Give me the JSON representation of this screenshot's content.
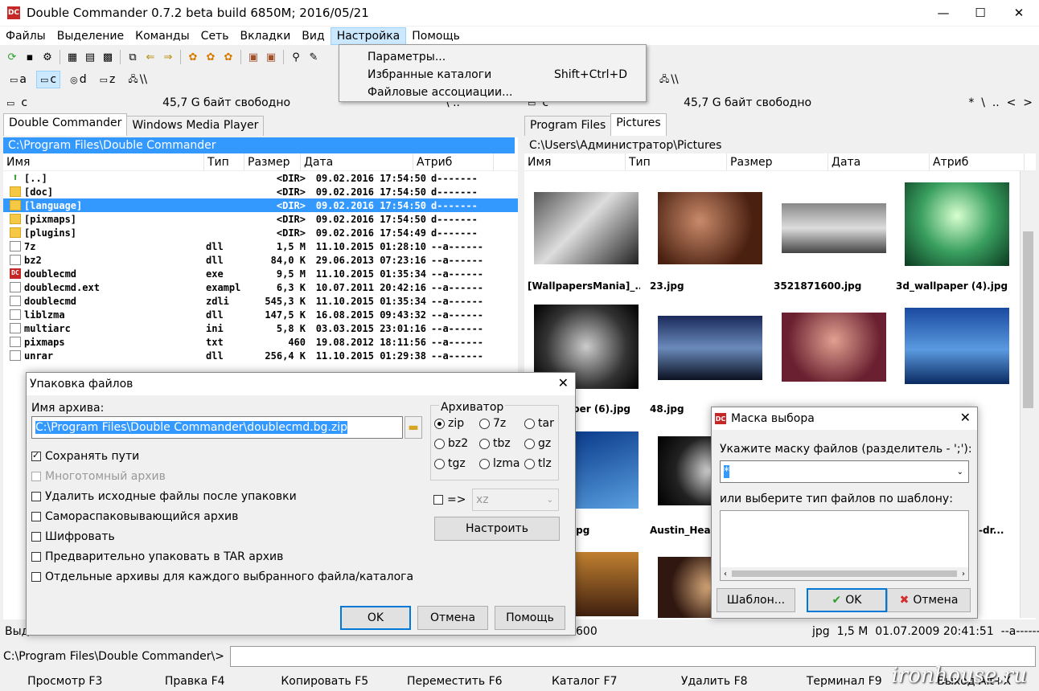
{
  "window": {
    "title": "Double Commander 0.7.2 beta build 6850M; 2016/05/21",
    "app_icon": "DC"
  },
  "menu": [
    "Файлы",
    "Выделение",
    "Команды",
    "Сеть",
    "Вкладки",
    "Вид",
    "Настройка",
    "Помощь"
  ],
  "settings_menu": {
    "items": [
      {
        "label": "Параметры...",
        "shortcut": ""
      },
      {
        "label": "Избранные каталоги",
        "shortcut": "Shift+Ctrl+D"
      },
      {
        "label": "Файловые ассоциации...",
        "shortcut": ""
      }
    ]
  },
  "left_drives": [
    "a",
    "c",
    "d",
    "z",
    "\\\\"
  ],
  "right_drives": [
    "\\\\"
  ],
  "left_panel": {
    "drive": "c",
    "free": "45,7 G байт свободно",
    "nav": "\\  ..",
    "tabs": [
      "Double Commander",
      "Windows Media Player"
    ],
    "path": "C:\\Program Files\\Double Commander",
    "columns": [
      "Имя",
      "Тип",
      "Размер",
      "Дата",
      "Атриб"
    ],
    "files": [
      {
        "name": "[..]",
        "type": "",
        "size": "<DIR>",
        "date": "09.02.2016 17:54:50",
        "attr": "d-------",
        "icon": "up"
      },
      {
        "name": "[doc]",
        "type": "",
        "size": "<DIR>",
        "date": "09.02.2016 17:54:50",
        "attr": "d-------",
        "icon": "folder"
      },
      {
        "name": "[language]",
        "type": "",
        "size": "<DIR>",
        "date": "09.02.2016 17:54:50",
        "attr": "d-------",
        "icon": "folder"
      },
      {
        "name": "[pixmaps]",
        "type": "",
        "size": "<DIR>",
        "date": "09.02.2016 17:54:50",
        "attr": "d-------",
        "icon": "folder"
      },
      {
        "name": "[plugins]",
        "type": "",
        "size": "<DIR>",
        "date": "09.02.2016 17:54:49",
        "attr": "d-------",
        "icon": "folder"
      },
      {
        "name": "7z",
        "type": "dll",
        "size": "1,5 M",
        "date": "11.10.2015 01:28:10",
        "attr": "--a------",
        "icon": "file"
      },
      {
        "name": "bz2",
        "type": "dll",
        "size": "84,0 K",
        "date": "29.06.2013 07:23:16",
        "attr": "--a------",
        "icon": "file"
      },
      {
        "name": "doublecmd",
        "type": "exe",
        "size": "9,5 M",
        "date": "11.10.2015 01:35:34",
        "attr": "--a------",
        "icon": "exe"
      },
      {
        "name": "doublecmd.ext",
        "type": "exampl",
        "size": "6,3 K",
        "date": "10.07.2011 20:42:16",
        "attr": "--a------",
        "icon": "file"
      },
      {
        "name": "doublecmd",
        "type": "zdli",
        "size": "545,3 K",
        "date": "11.10.2015 01:35:34",
        "attr": "--a------",
        "icon": "file"
      },
      {
        "name": "liblzma",
        "type": "dll",
        "size": "147,5 K",
        "date": "16.08.2015 09:43:32",
        "attr": "--a------",
        "icon": "file"
      },
      {
        "name": "multiarc",
        "type": "ini",
        "size": "5,8 K",
        "date": "03.03.2015 23:01:16",
        "attr": "--a------",
        "icon": "file"
      },
      {
        "name": "pixmaps",
        "type": "txt",
        "size": "460",
        "date": "19.08.2012 18:11:56",
        "attr": "--a------",
        "icon": "file"
      },
      {
        "name": "unrar",
        "type": "dll",
        "size": "256,4 K",
        "date": "11.10.2015 01:29:38",
        "attr": "--a------",
        "icon": "file"
      }
    ],
    "status": "Выд"
  },
  "right_panel": {
    "drive": "c",
    "free": "45,7 G байт свободно",
    "nav": "*  \\  ..  <  >",
    "tabs": [
      "Program Files",
      "Pictures"
    ],
    "path": "C:\\Users\\Администратор\\Pictures",
    "columns": [
      "Имя",
      "Тип",
      "Размер",
      "Дата",
      "Атриб"
    ],
    "thumb_labels": [
      "[WallpapersMania]_...",
      "23.jpg",
      "3521871600.jpg",
      "3d_wallpaper (4).jpg",
      "per (6).jpg",
      "48.jpg",
      "jpg",
      "Austin_Heal",
      "-dr..."
    ],
    "status": "600",
    "status_right": "jpg  1,5 M  01.07.2009 20:41:51  --a------"
  },
  "pack_dialog": {
    "title": "Упаковка файлов",
    "archive_label": "Имя архива:",
    "archive_value": "C:\\Program Files\\Double Commander\\doublecmd.bg.zip",
    "options": [
      {
        "label": "Сохранять пути",
        "checked": true,
        "disabled": false
      },
      {
        "label": "Многотомный архив",
        "checked": false,
        "disabled": true
      },
      {
        "label": "Удалить исходные файлы после упаковки",
        "checked": false,
        "disabled": false
      },
      {
        "label": "Самораспаковывающийся архив",
        "checked": false,
        "disabled": false
      },
      {
        "label": "Шифровать",
        "checked": false,
        "disabled": false
      },
      {
        "label": "Предварительно упаковать в TAR архив",
        "checked": false,
        "disabled": false
      },
      {
        "label": "Отдельные архивы для каждого выбранного файла/каталога",
        "checked": false,
        "disabled": false
      }
    ],
    "archiver_label": "Архиватор",
    "archivers": [
      "zip",
      "7z",
      "tar",
      "bz2",
      "tbz",
      "gz",
      "tgz",
      "lzma",
      "tlz"
    ],
    "selected_archiver": "zip",
    "arrow_label": "=>",
    "xz_value": "xz",
    "configure": "Настроить",
    "ok": "OK",
    "cancel": "Отмена",
    "help": "Помощь"
  },
  "mask_dialog": {
    "title": "Маска выбора",
    "mask_label": "Укажите маску файлов (разделитель - ';'):",
    "mask_value": "*",
    "template_label": "или выберите тип файлов по шаблону:",
    "template_btn": "Шаблон...",
    "ok": "OK",
    "cancel": "Отмена"
  },
  "cmdline": {
    "prompt": "C:\\Program Files\\Double Commander\\>"
  },
  "fkeys": [
    "Просмотр F3",
    "Правка F4",
    "Копировать F5",
    "Переместить F6",
    "Каталог F7",
    "Удалить F8",
    "Терминал F9",
    "Выход Alt+X"
  ],
  "watermark": "ironhouse.ru"
}
